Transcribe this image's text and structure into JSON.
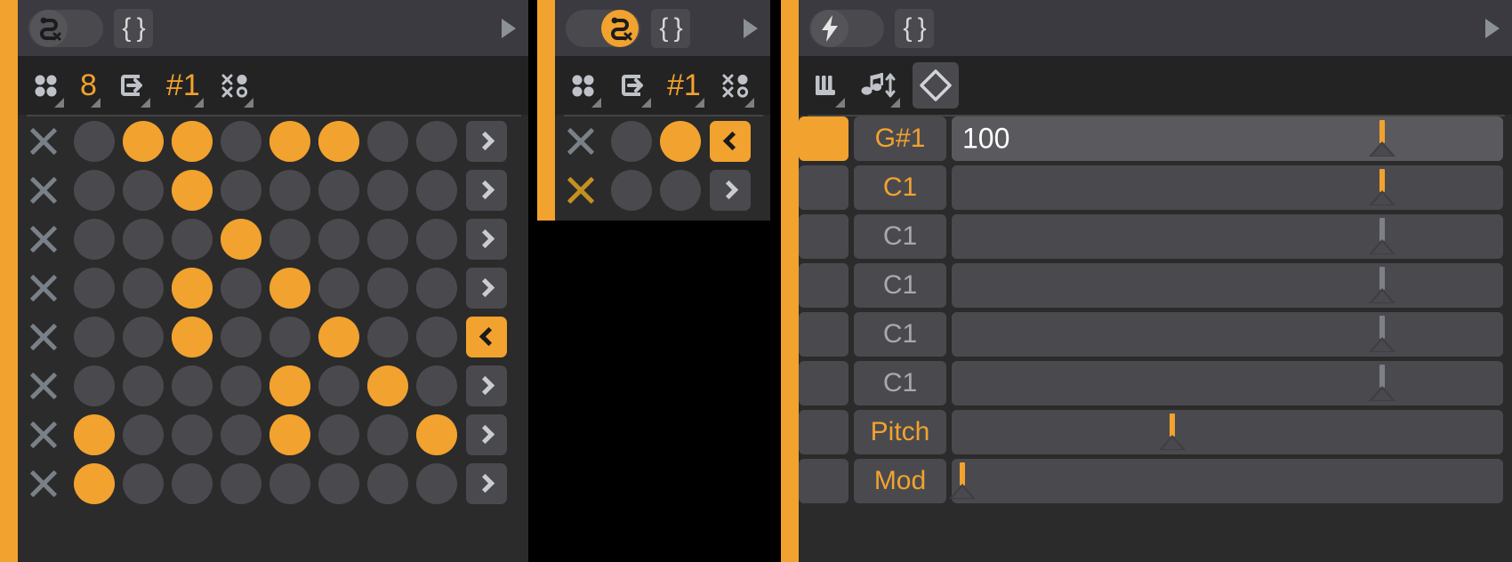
{
  "panels": [
    {
      "name": "sequencer-panel-1",
      "accent_color": "#f2a22e",
      "titlebar": {
        "toggle_icon": "snake-path-icon",
        "toggle_on": false,
        "braces_label": "{ }",
        "play_icon": "play-triangle-icon"
      },
      "toolbar": {
        "items": [
          {
            "type": "icon",
            "icon": "four-dots-icon",
            "label": ""
          },
          {
            "type": "number",
            "icon": "",
            "label": "8"
          },
          {
            "type": "icon",
            "icon": "step-in-icon",
            "label": ""
          },
          {
            "type": "number",
            "icon": "",
            "label": "#1"
          },
          {
            "type": "icon",
            "icon": "xo-matrix-icon",
            "label": ""
          }
        ]
      },
      "grid": {
        "columns": 8,
        "rows": [
          {
            "mute_icon": "x-icon",
            "mute_active": false,
            "steps": [
              0,
              100,
              55,
              0,
              45,
              45,
              0,
              0
            ],
            "arrow_icon": "chevron-right-icon",
            "arrow_selected": false
          },
          {
            "mute_icon": "x-icon",
            "mute_active": false,
            "steps": [
              0,
              0,
              100,
              0,
              0,
              0,
              0,
              0
            ],
            "arrow_icon": "chevron-right-icon",
            "arrow_selected": false
          },
          {
            "mute_icon": "x-icon",
            "mute_active": false,
            "steps": [
              0,
              0,
              0,
              100,
              0,
              0,
              0,
              0
            ],
            "arrow_icon": "chevron-right-icon",
            "arrow_selected": false
          },
          {
            "mute_icon": "x-icon",
            "mute_active": false,
            "steps": [
              0,
              0,
              52,
              0,
              100,
              0,
              0,
              0
            ],
            "arrow_icon": "chevron-right-icon",
            "arrow_selected": false
          },
          {
            "mute_icon": "x-icon",
            "mute_active": false,
            "steps": [
              0,
              0,
              52,
              0,
              0,
              100,
              0,
              0
            ],
            "arrow_icon": "chevron-left-icon",
            "arrow_selected": true
          },
          {
            "mute_icon": "x-icon",
            "mute_active": false,
            "steps": [
              0,
              0,
              0,
              0,
              52,
              0,
              100,
              0
            ],
            "arrow_icon": "chevron-right-icon",
            "arrow_selected": false
          },
          {
            "mute_icon": "x-icon",
            "mute_active": false,
            "steps": [
              42,
              0,
              0,
              0,
              52,
              0,
              0,
              100
            ],
            "arrow_icon": "chevron-right-icon",
            "arrow_selected": false
          },
          {
            "mute_icon": "x-icon",
            "mute_active": false,
            "steps": [
              100,
              0,
              0,
              0,
              0,
              0,
              0,
              0
            ],
            "arrow_icon": "chevron-right-icon",
            "arrow_selected": false
          }
        ]
      }
    },
    {
      "name": "sequencer-panel-2",
      "accent_color": "#f2a22e",
      "titlebar": {
        "toggle_icon": "snake-path-icon",
        "toggle_on": true,
        "braces_label": "{ }",
        "play_icon": "play-triangle-icon"
      },
      "toolbar": {
        "items": [
          {
            "type": "icon",
            "icon": "four-dots-icon",
            "label": ""
          },
          {
            "type": "icon",
            "icon": "step-in-icon",
            "label": ""
          },
          {
            "type": "number",
            "icon": "",
            "label": "#1"
          },
          {
            "type": "icon",
            "icon": "xo-matrix-icon",
            "label": ""
          }
        ]
      },
      "grid": {
        "columns": 2,
        "rows": [
          {
            "mute_icon": "x-icon",
            "mute_active": false,
            "steps": [
              0,
              50
            ],
            "arrow_icon": "chevron-left-icon",
            "arrow_selected": true
          },
          {
            "mute_icon": "x-icon",
            "mute_active": true,
            "steps": [
              0,
              0
            ],
            "arrow_icon": "chevron-right-icon",
            "arrow_selected": false
          }
        ]
      }
    },
    {
      "name": "note-panel-3",
      "accent_color": "#f2a22e",
      "titlebar": {
        "toggle_icon": "lightning-bolt-icon",
        "toggle_on": false,
        "braces_label": "{ }",
        "play_icon": "play-triangle-icon"
      },
      "toolbar": {
        "items": [
          {
            "type": "icon",
            "icon": "piano-keys-icon",
            "label": ""
          },
          {
            "type": "icon",
            "icon": "note-updown-icon",
            "label": ""
          },
          {
            "type": "icon",
            "icon": "diamond-icon",
            "label": "",
            "boxed": true
          }
        ]
      },
      "note_rows": [
        {
          "swatch_on": true,
          "note": "G#1",
          "note_accent": true,
          "value": "100",
          "slider_pct": 78,
          "slider_accent": true,
          "highlight": true
        },
        {
          "swatch_on": false,
          "note": "C1",
          "note_accent": true,
          "value": "",
          "slider_pct": 78,
          "slider_accent": true,
          "highlight": false
        },
        {
          "swatch_on": false,
          "note": "C1",
          "note_accent": false,
          "value": "",
          "slider_pct": 78,
          "slider_accent": false,
          "highlight": false
        },
        {
          "swatch_on": false,
          "note": "C1",
          "note_accent": false,
          "value": "",
          "slider_pct": 78,
          "slider_accent": false,
          "highlight": false
        },
        {
          "swatch_on": false,
          "note": "C1",
          "note_accent": false,
          "value": "",
          "slider_pct": 78,
          "slider_accent": false,
          "highlight": false
        },
        {
          "swatch_on": false,
          "note": "C1",
          "note_accent": false,
          "value": "",
          "slider_pct": 78,
          "slider_accent": false,
          "highlight": false
        },
        {
          "swatch_on": false,
          "note": "Pitch",
          "note_accent": true,
          "value": "",
          "slider_pct": 40,
          "slider_accent": true,
          "highlight": false
        },
        {
          "swatch_on": false,
          "note": "Mod",
          "note_accent": true,
          "value": "",
          "slider_pct": 2,
          "slider_accent": true,
          "highlight": false
        }
      ]
    }
  ]
}
